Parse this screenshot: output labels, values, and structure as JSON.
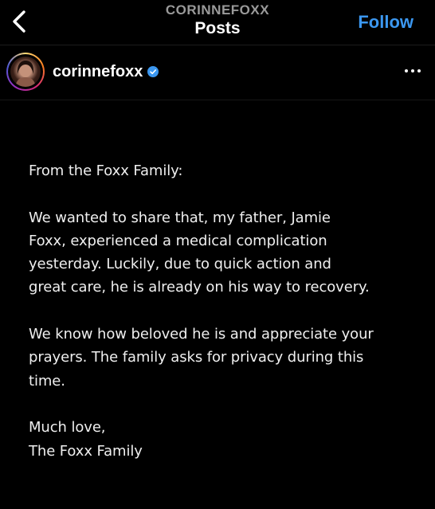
{
  "header": {
    "account_name": "CORINNEFOXX",
    "title": "Posts",
    "follow_label": "Follow",
    "back_icon": "chevron-left-icon"
  },
  "post": {
    "username": "corinnefoxx",
    "verified": true,
    "more_icon": "more-horizontal-icon",
    "paragraphs": [
      "From the Foxx Family:",
      "We wanted to share that, my father, Jamie\nFoxx, experienced a medical complication\nyesterday. Luckily, due to quick action and\ngreat care, he is already on his way to recovery.",
      "We know how beloved he is and appreciate your\nprayers. The family asks for privacy during this\ntime.",
      "Much love,\nThe Foxx Family"
    ]
  },
  "colors": {
    "background": "#000000",
    "accent": "#3b97f0",
    "text": "#efefef",
    "muted": "#9a9a9a"
  }
}
